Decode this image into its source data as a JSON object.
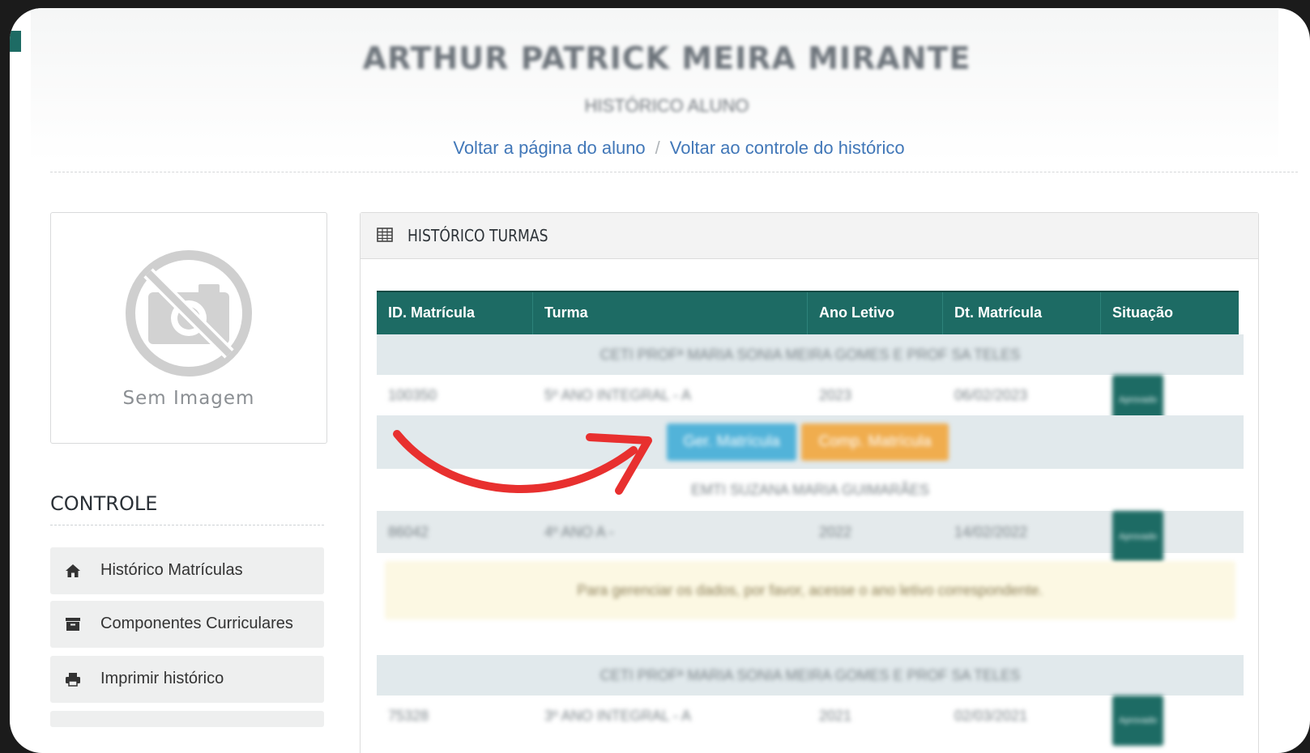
{
  "header": {
    "student_name": "ARTHUR PATRICK MEIRA MIRANTE",
    "subtitle": "HISTÓRICO ALUNO",
    "breadcrumb": {
      "back_student": "Voltar a página do aluno",
      "separator": "/",
      "back_history": "Voltar ao controle do histórico"
    }
  },
  "photo": {
    "label": "Sem Imagem",
    "icon": "no-camera-icon"
  },
  "control": {
    "title": "CONTROLE",
    "items": [
      {
        "label": "Histórico Matrículas",
        "icon": "home-icon"
      },
      {
        "label": "Componentes Curriculares",
        "icon": "archive-icon"
      },
      {
        "label": "Imprimir histórico",
        "icon": "print-icon"
      }
    ]
  },
  "panel": {
    "title": "HISTÓRICO TURMAS",
    "icon": "table-icon",
    "columns": [
      "ID. Matrícula",
      "Turma",
      "Ano Letivo",
      "Dt. Matrícula",
      "Situação"
    ],
    "groups": [
      {
        "school": "CETI PROFª MARIA SONIA MEIRA GOMES E PROF SA TELES",
        "rows": [
          {
            "id": "100350",
            "turma": "5º ANO INTEGRAL - A",
            "ano": "2023",
            "data": "06/02/2023",
            "situacao": "Aprovado"
          }
        ],
        "actions": {
          "primary": "Ger. Matrícula",
          "secondary": "Comp. Matrícula"
        }
      },
      {
        "school": "EMTI SUZANA MARIA GUIMARÃES",
        "rows": [
          {
            "id": "86042",
            "turma": "4º ANO A -",
            "ano": "2022",
            "data": "14/02/2022",
            "situacao": "Aprovado"
          }
        ],
        "notice": "Para gerenciar os dados, por favor, acesse o ano letivo correspondente."
      },
      {
        "school": "CETI PROFª MARIA SONIA MEIRA GOMES E PROF SA TELES",
        "rows": [
          {
            "id": "75328",
            "turma": "3º ANO INTEGRAL - A",
            "ano": "2021",
            "data": "02/03/2021",
            "situacao": "Aprovado"
          }
        ]
      }
    ]
  },
  "colors": {
    "table_header": "#1d6b64",
    "link": "#4177b8",
    "btn_primary": "#52b3d9",
    "btn_secondary": "#f0ad4e",
    "annotation_arrow": "#e8302f"
  }
}
